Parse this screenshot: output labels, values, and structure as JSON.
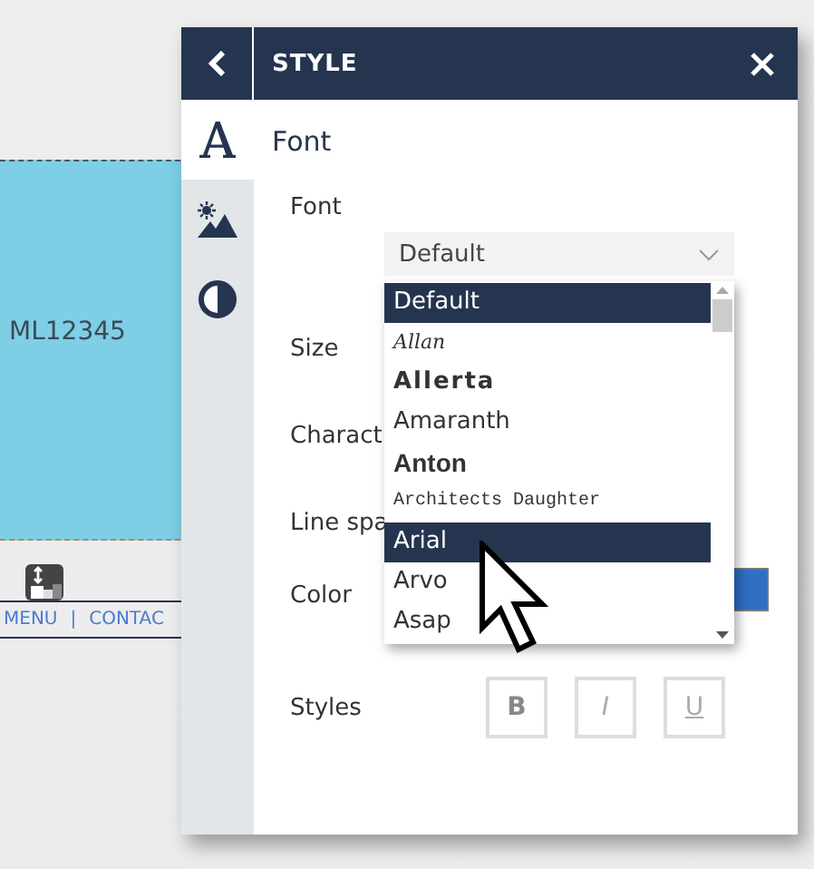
{
  "page": {
    "code": "ML12345",
    "links": [
      "MENU",
      "|",
      "CONTAC"
    ]
  },
  "panel": {
    "title": "STYLE",
    "rail": [
      {
        "kind": "font",
        "selected": true
      },
      {
        "kind": "image",
        "selected": false
      },
      {
        "kind": "contrast",
        "selected": false
      }
    ],
    "section": "Font",
    "font_label": "Font",
    "font_select": {
      "value": "Default",
      "open": true
    },
    "labels": [
      "Size",
      "Charact",
      "Line spa",
      "Color",
      "Styles"
    ],
    "swatch": {
      "color": "#2f6fc4"
    },
    "dropdown": [
      {
        "label": "Default",
        "kind": "plain",
        "highlighted": true
      },
      {
        "label": "Allan",
        "kind": "script",
        "highlighted": false
      },
      {
        "label": "Allerta",
        "kind": "wide",
        "highlighted": false
      },
      {
        "label": "Amaranth",
        "kind": "plain",
        "highlighted": false
      },
      {
        "label": "Anton",
        "kind": "condensed",
        "highlighted": false
      },
      {
        "label": "Architects Daughter",
        "kind": "hand",
        "highlighted": false
      },
      {
        "label": "Arial",
        "kind": "plain",
        "highlighted": true
      },
      {
        "label": "Arvo",
        "kind": "plain",
        "highlighted": false
      },
      {
        "label": "Asap",
        "kind": "plain",
        "highlighted": false
      }
    ],
    "styles": [
      {
        "label": "B",
        "kind": "bold",
        "on": false
      },
      {
        "label": "I",
        "kind": "italic",
        "on": false
      },
      {
        "label": "U",
        "kind": "underline",
        "on": false
      }
    ]
  }
}
